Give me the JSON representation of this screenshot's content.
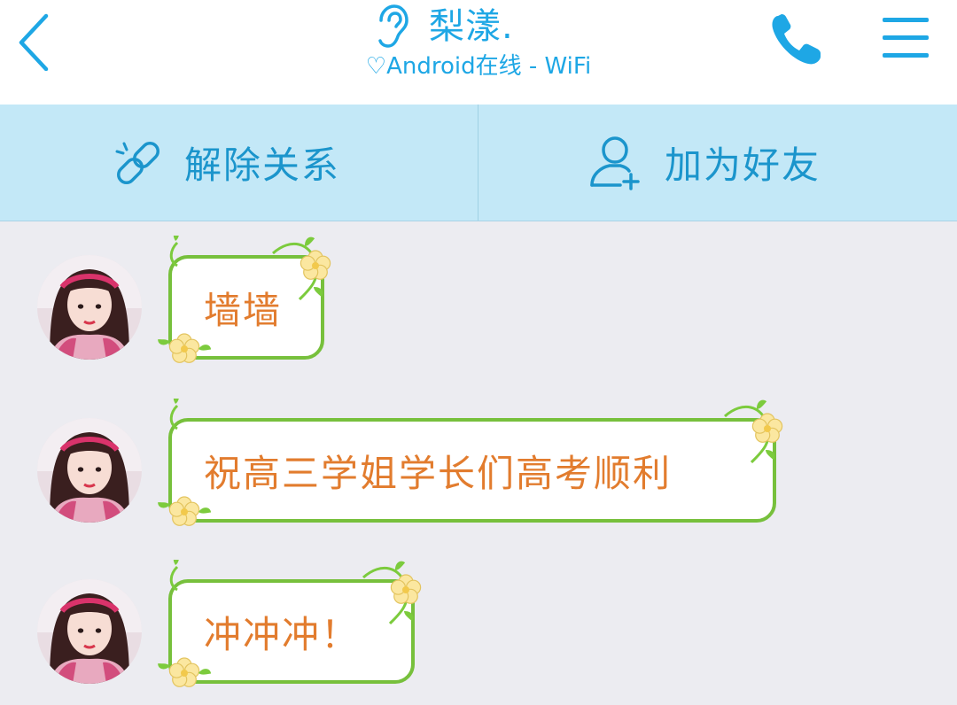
{
  "header": {
    "title": "梨漾.",
    "subtitle": "♡Android在线 - WiFi",
    "back_icon": "chevron-left-icon",
    "ear_icon": "ear-icon",
    "phone_icon": "phone-icon",
    "menu_icon": "menu-icon"
  },
  "actions": {
    "unlink_label": "解除关系",
    "add_friend_label": "加为好友",
    "unlink_icon": "link-broken-icon",
    "add_friend_icon": "add-user-icon"
  },
  "messages": [
    {
      "text": "墙墙"
    },
    {
      "text": "祝高三学姐学长们高考顺利"
    },
    {
      "text": "冲冲冲！"
    }
  ],
  "colors": {
    "accent": "#1ea7e5",
    "action_bar": "#c3e8f7",
    "bubble_border": "#77c03c",
    "message_text": "#e27c2e",
    "background": "#ececf1"
  }
}
